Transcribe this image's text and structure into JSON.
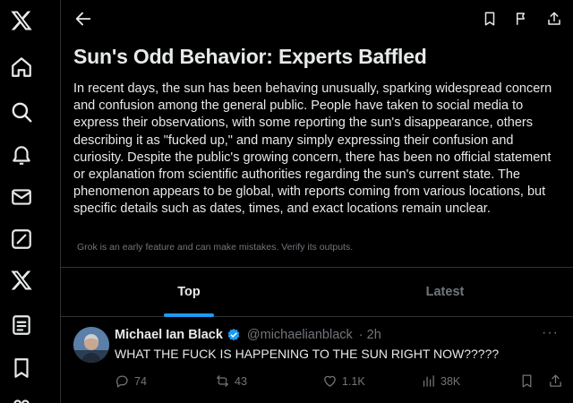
{
  "sidebar": {
    "items": [
      {
        "icon": "x-logo-icon"
      },
      {
        "icon": "home-icon"
      },
      {
        "icon": "search-icon"
      },
      {
        "icon": "notifications-bell-icon"
      },
      {
        "icon": "messages-envelope-icon"
      },
      {
        "icon": "grok-icon"
      },
      {
        "icon": "x-premium-icon"
      },
      {
        "icon": "lists-icon"
      },
      {
        "icon": "bookmarks-icon"
      },
      {
        "icon": "communities-icon"
      }
    ]
  },
  "topbar": {
    "back_icon": "arrow-left-icon",
    "actions": [
      "bookmark-icon",
      "flag-icon",
      "share-icon"
    ]
  },
  "story": {
    "title": "Sun's Odd Behavior: Experts Baffled",
    "summary": "In recent days, the sun has been behaving unusually, sparking widespread concern and confusion among the general public. People have taken to social media to express their observations, with some reporting the sun's disappearance, others describing it as \"fucked up,\" and many simply expressing their confusion and curiosity. Despite the public's growing concern, there has been no official statement or explanation from scientific authorities regarding the sun's current state. The phenomenon appears to be global, with reports coming from various locations, but specific details such as dates, times, and exact locations remain unclear.",
    "disclaimer": "Grok is an early feature and can make mistakes. Verify its outputs."
  },
  "tabs": [
    {
      "label": "Top",
      "active": true
    },
    {
      "label": "Latest",
      "active": false
    }
  ],
  "post": {
    "name": "Michael Ian Black",
    "handle": "@michaelianblack",
    "time": "· 2h",
    "more": "···",
    "text": "WHAT THE FUCK IS HAPPENING TO THE SUN RIGHT NOW?????",
    "replies": "74",
    "reposts": "43",
    "likes": "1.1K",
    "views": "38K"
  },
  "colors": {
    "background": "#000000",
    "text": "#e7e9ea",
    "muted": "#71767b",
    "accent": "#1d9bf0",
    "divider": "#2f3336"
  }
}
